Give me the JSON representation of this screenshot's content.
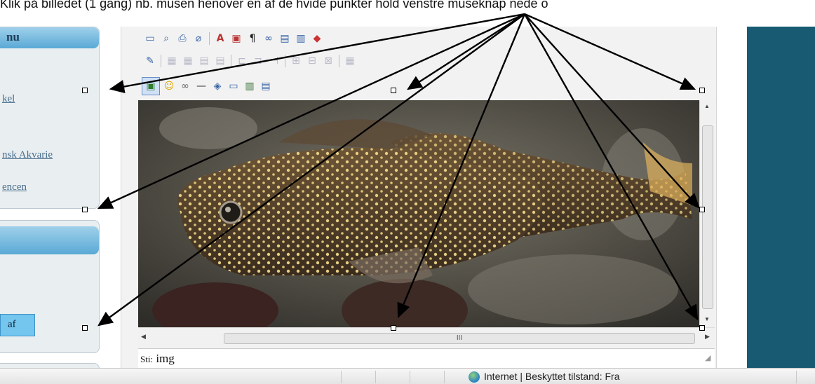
{
  "caption": "Klik på billedet (1 gang) nb. musen henover en af de hvide punkter hold venstre museknap nede o",
  "sidebar": {
    "menu_title": "nu",
    "links": [
      "kel",
      "nsk Akvarie",
      "encen"
    ],
    "button_label": "af"
  },
  "editor": {
    "toolbar_icons": {
      "row1": [
        "preview-icon",
        "find-icon",
        "print-icon",
        "eraser-icon",
        "font-color-icon",
        "paste-icon",
        "pilcrow-icon",
        "link-icon",
        "table-icon",
        "columns-icon",
        "flash-icon"
      ],
      "row2": [
        "edit-icon",
        "row-before-icon",
        "row-after-icon",
        "row-delete-icon",
        "merge-icon",
        "col-before-icon",
        "col-after-icon",
        "col-delete-icon",
        "split-icon",
        "cell-props-icon",
        "table-props-icon",
        "table-grid-icon"
      ],
      "row3": [
        "image-icon",
        "smiley-icon",
        "link-chain-icon",
        "horizontal-rule-icon",
        "anchor-icon",
        "template-icon",
        "media-icon",
        "file-icon"
      ]
    },
    "image_subject": "pleco-fish-photo",
    "hscroll_grip": "III",
    "path_label": "Sti:",
    "path_value": "img"
  },
  "statusbar": {
    "text": "Internet | Beskyttet tilstand: Fra"
  },
  "colors": {
    "panel_head": "#5aa9d6",
    "right_panel": "#185a72",
    "handle_border": "#000000"
  }
}
